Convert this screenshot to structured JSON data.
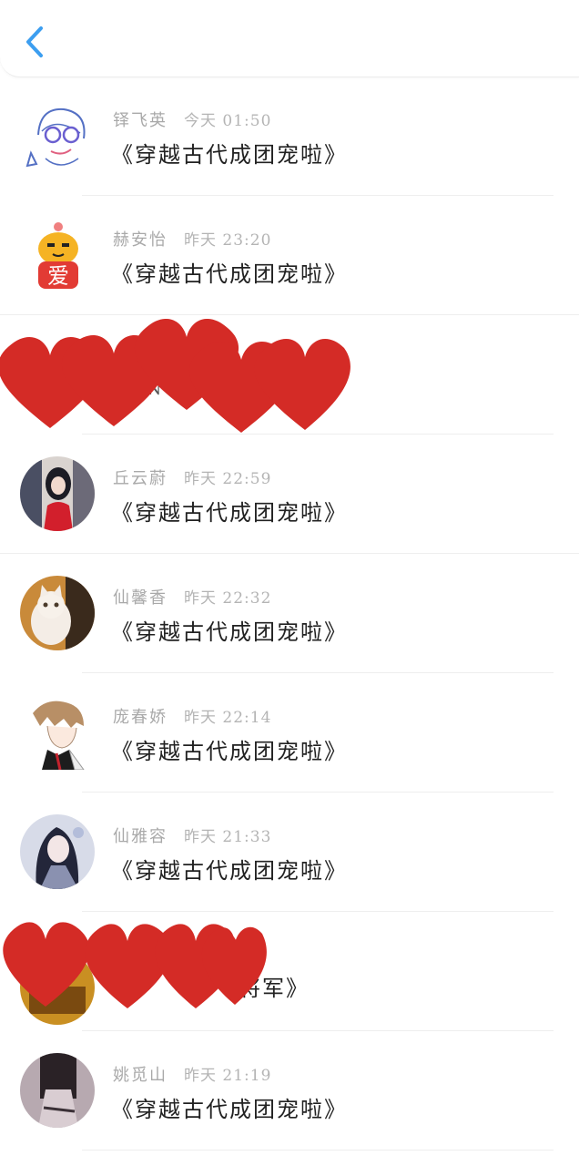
{
  "header": {
    "back_icon": "chevron-left-icon",
    "accent": "#3c9ef0"
  },
  "rows": [
    {
      "name": "铎飞英",
      "time": "今天 01:50",
      "message": "《穿越古代成团宠啦》",
      "avatar": "doodle-girl-avatar"
    },
    {
      "name": "赫安怡",
      "time": "昨天 23:20",
      "message": "《穿越古代成团宠啦》",
      "avatar": "love-cat-avatar"
    },
    {
      "name": "",
      "time": "",
      "message": "N",
      "avatar": ""
    },
    {
      "name": "丘云蔚",
      "time": "昨天 22:59",
      "message": "《穿越古代成团宠啦》",
      "avatar": "girl-red-dress-avatar"
    },
    {
      "name": "仙馨香",
      "time": "昨天 22:32",
      "message": "《穿越古代成团宠啦》",
      "avatar": "white-cat-avatar"
    },
    {
      "name": "庞春娇",
      "time": "昨天 22:14",
      "message": "《穿越古代成团宠啦》",
      "avatar": "anime-boy-avatar"
    },
    {
      "name": "仙雅容",
      "time": "昨天 21:33",
      "message": "《穿越古代成团宠啦》",
      "avatar": "ancient-style-avatar"
    },
    {
      "name": "",
      "time": "",
      "message": "将军》",
      "avatar": ""
    },
    {
      "name": "姚觅山",
      "time": "昨天 21:19",
      "message": "《穿越古代成团宠啦》",
      "avatar": "dark-portrait-avatar"
    }
  ],
  "redaction_color": "#d42b26"
}
